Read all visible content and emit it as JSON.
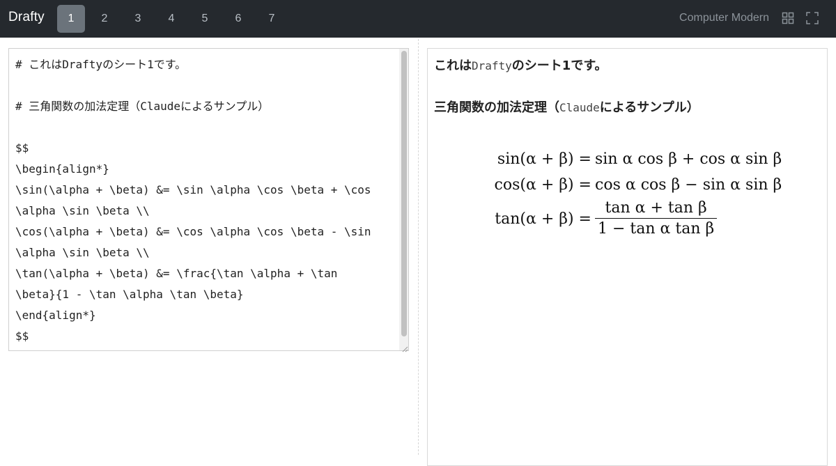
{
  "app": {
    "title": "Drafty"
  },
  "pages": [
    {
      "label": "1",
      "active": true
    },
    {
      "label": "2",
      "active": false
    },
    {
      "label": "3",
      "active": false
    },
    {
      "label": "4",
      "active": false
    },
    {
      "label": "5",
      "active": false
    },
    {
      "label": "6",
      "active": false
    },
    {
      "label": "7",
      "active": false
    }
  ],
  "toolbar": {
    "font_name": "Computer Modern",
    "icons": [
      "grid-layout-icon",
      "fullscreen-icon"
    ]
  },
  "editor": {
    "lines": [
      "# これはDraftyのシート1です。",
      "",
      "# 三角関数の加法定理（Claudeによるサンプル）",
      "",
      "$$",
      "\\begin{align*}",
      "\\sin(\\alpha + \\beta) &= \\sin \\alpha \\cos \\beta + \\cos",
      "\\alpha \\sin \\beta \\\\",
      "\\cos(\\alpha + \\beta) &= \\cos \\alpha \\cos \\beta - \\sin",
      "\\alpha \\sin \\beta \\\\",
      "\\tan(\\alpha + \\beta) &= \\frac{\\tan \\alpha + \\tan",
      "\\beta}{1 - \\tan \\alpha \\tan \\beta}",
      "\\end{align*}",
      "$$"
    ]
  },
  "preview": {
    "heading1": {
      "pre": "これは",
      "code": "Drafty",
      "post": "のシート1です。"
    },
    "heading2": {
      "pre": "三角関数の加法定理（",
      "code": "Claude",
      "post": "によるサンプル）"
    },
    "equations": {
      "eq1_left": "sin(α + β) =",
      "eq1_right": "sin α cos β + cos α sin β",
      "eq2_left": "cos(α + β) =",
      "eq2_right": "cos α cos β − sin α sin β",
      "eq3_left": "tan(α + β) =",
      "eq3_num": "tan α + tan β",
      "eq3_den": "1 − tan α tan β"
    }
  }
}
